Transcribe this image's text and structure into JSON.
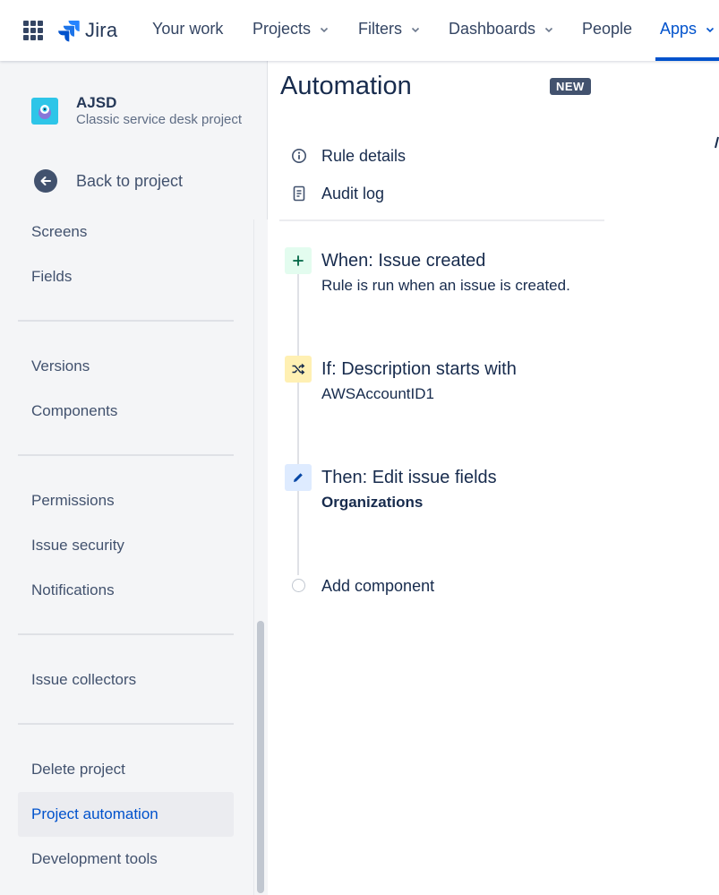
{
  "topnav": {
    "logo_text": "Jira",
    "items": [
      {
        "label": "Your work"
      },
      {
        "label": "Projects"
      },
      {
        "label": "Filters"
      },
      {
        "label": "Dashboards"
      },
      {
        "label": "People"
      },
      {
        "label": "Apps"
      }
    ],
    "active_item": "Apps",
    "accent_color": "#0052cc"
  },
  "sidebar": {
    "project": {
      "name": "AJSD",
      "type": "Classic service desk project"
    },
    "back_label": "Back to project",
    "items": [
      {
        "label": "Screens"
      },
      {
        "label": "Fields"
      },
      {
        "label": "Versions"
      },
      {
        "label": "Components"
      },
      {
        "label": "Permissions"
      },
      {
        "label": "Issue security"
      },
      {
        "label": "Notifications"
      },
      {
        "label": "Issue collectors"
      },
      {
        "label": "Delete project"
      },
      {
        "label": "Project automation"
      },
      {
        "label": "Development tools"
      }
    ],
    "selected_item": "Project automation"
  },
  "main": {
    "title": "Automation",
    "badge": "NEW",
    "links": [
      {
        "label": "Rule details",
        "icon": "info-icon"
      },
      {
        "label": "Audit log",
        "icon": "document-icon"
      }
    ],
    "steps": [
      {
        "title": "When: Issue created",
        "subtitle": "Rule is run when an issue is created.",
        "icon": "plus-icon",
        "color": "#e3fcef"
      },
      {
        "title": "If: Description starts with",
        "subtitle": "AWSAccountID1",
        "icon": "shuffle-icon",
        "color": "#fff0b3"
      },
      {
        "title": "Then: Edit issue fields",
        "subtitle": "Organizations",
        "icon": "pencil-icon",
        "color": "#deebff"
      }
    ],
    "add_component_label": "Add component"
  }
}
